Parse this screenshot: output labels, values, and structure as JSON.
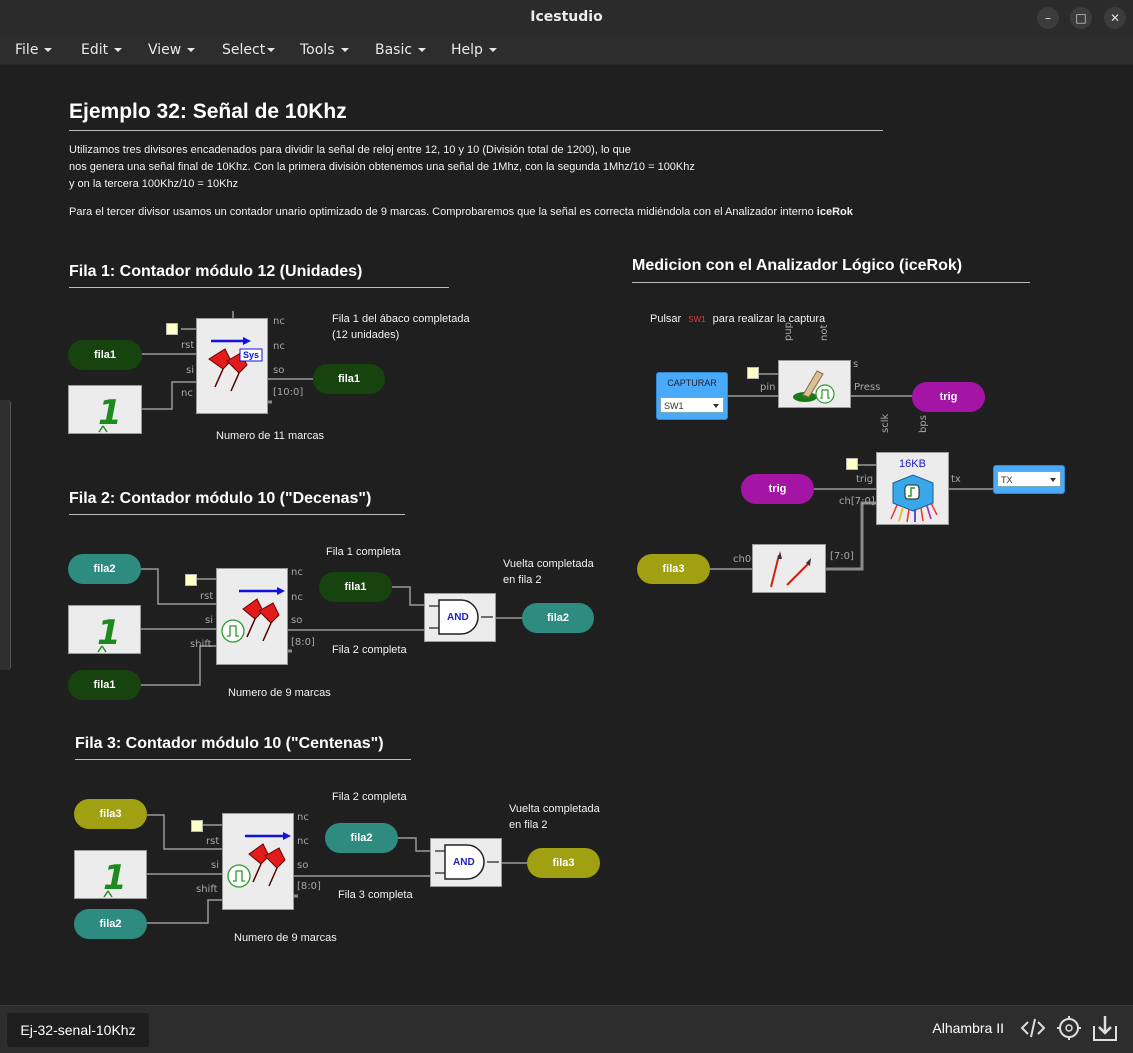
{
  "window": {
    "title": "Icestudio"
  },
  "menu": [
    {
      "label": "File"
    },
    {
      "label": "Edit"
    },
    {
      "label": "View"
    },
    {
      "label": "Select"
    },
    {
      "label": "Tools"
    },
    {
      "label": "Basic"
    },
    {
      "label": "Help"
    }
  ],
  "doc": {
    "title": "Ejemplo 32: Señal de 10Khz",
    "para1_line1": "Utilizamos tres divisores encadenados para dividir la señal de reloj entre 12, 10 y 10 (División total de 1200), lo que",
    "para1_line2": "nos genera una señal final de 10Khz. Con la primera división obtenemos una señal de 1Mhz, con la segunda 1Mhz/10 = 100Khz",
    "para1_line3": "y on la tercera 100Khz/10 = 10Khz",
    "para2": "Para el tercer divisor usamos un contador unario optimizado de 9 marcas. Comprobaremos que la señal es correcta midiéndola con el Analizador interno",
    "para2_bold": "iceRok"
  },
  "fila1": {
    "heading": "Fila 1: Contador módulo 12 (Unidades)",
    "note_line1": "Fila 1 del ábaco completada",
    "note_line2": "(12 unidades)",
    "caption": "Numero de 11 marcas",
    "in_label": "fila1",
    "out_label": "fila1",
    "ports": {
      "rst": "rst",
      "si": "si",
      "nc_in": "nc",
      "nc1": "nc",
      "nc2": "nc",
      "so": "so",
      "bus": "[10:0]"
    },
    "sys": "Sys"
  },
  "fila2": {
    "heading": "Fila 2: Contador módulo 10 (\"Decenas\")",
    "in_top": "fila2",
    "in_bottom": "fila1",
    "mid_label": "fila1",
    "out_label": "fila2",
    "note_top": "Fila 1 completa",
    "note_vuelta1": "Vuelta completada",
    "note_vuelta2": "en fila 2",
    "note_bottom": "Fila 2 completa",
    "caption": "Numero de 9 marcas",
    "ports": {
      "rst": "rst",
      "si": "si",
      "shift": "shift",
      "nc1": "nc",
      "nc2": "nc",
      "so": "so",
      "bus": "[8:0]"
    },
    "gate": "AND"
  },
  "fila3": {
    "heading": "Fila 3: Contador módulo 10 (\"Centenas\")",
    "in_top": "fila3",
    "in_bottom": "fila2",
    "mid_label": "fila2",
    "out_label": "fila3",
    "note_top": "Fila 2 completa",
    "note_vuelta1": "Vuelta completada",
    "note_vuelta2": "en fila 2",
    "note_bottom": "Fila 3 completa",
    "caption": "Numero de 9 marcas",
    "ports": {
      "rst": "rst",
      "si": "si",
      "shift": "shift",
      "nc1": "nc",
      "nc2": "nc",
      "so": "so",
      "bus": "[8:0]"
    },
    "gate": "AND"
  },
  "analyzer": {
    "heading": "Medicion con el Analizador Lógico (iceRok)",
    "pulsar": "Pulsar",
    "sw_tag": "SW1",
    "pulsar_rest": "para realizar la captura",
    "capturar_title": "CAPTURAR",
    "capturar_value": "SW1",
    "button_ports": {
      "pup": "pup",
      "not": "not",
      "s": "s",
      "pin": "pin",
      "press": "Press"
    },
    "trig_out": "trig",
    "trig_in": "trig",
    "rok_size": "16KB",
    "rok_ports": {
      "sclk": "sclk",
      "bps": "bps",
      "trig": "trig",
      "ch": "ch[7:0]",
      "tx": "tx"
    },
    "tx_value": "TX",
    "fila3": "fila3",
    "ch0": "ch0",
    "bus": "[7:0]"
  },
  "status": {
    "tab": "Ej-32-senal-10Khz",
    "board": "Alhambra II"
  },
  "colors": {
    "dark_green": "#17430f",
    "teal": "#2e8b80",
    "olive": "#a0a012",
    "magenta": "#a414a5",
    "blue": "#4aaafa"
  }
}
